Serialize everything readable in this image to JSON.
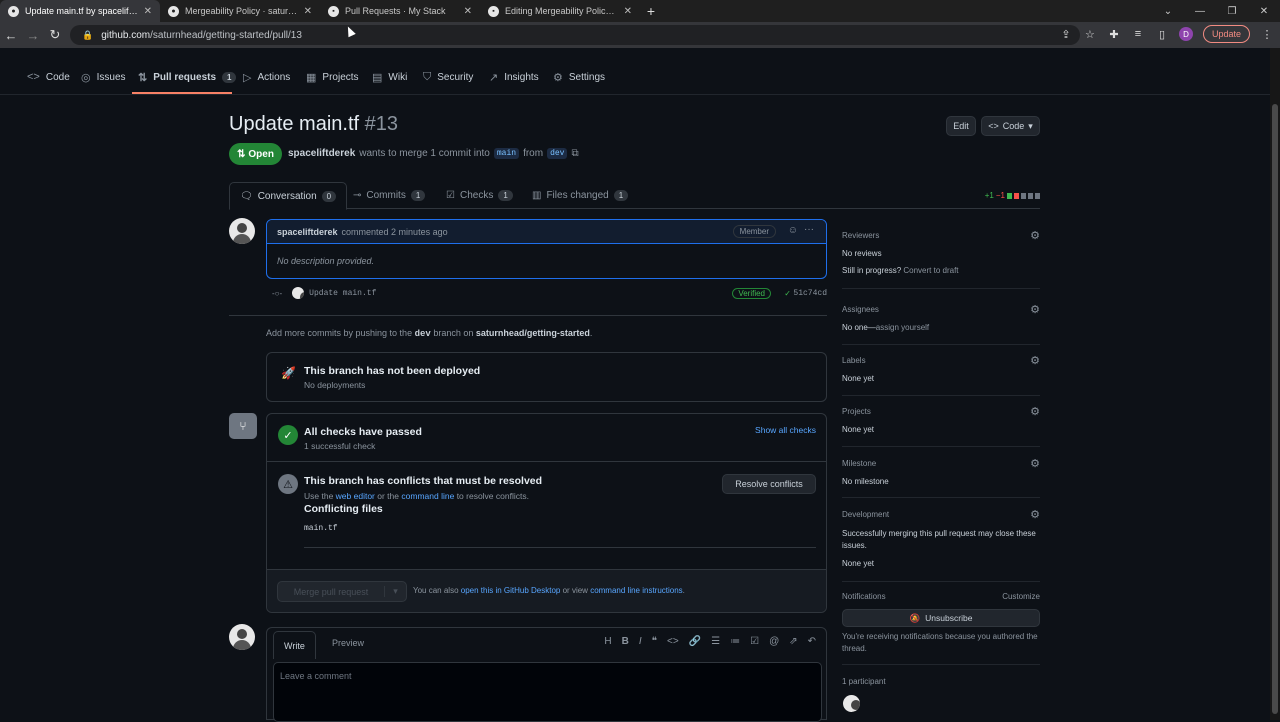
{
  "browser": {
    "tabs": [
      {
        "title": "Update main.tf by spaceliftderek",
        "active": true
      },
      {
        "title": "Mergeability Policy · saturnhead",
        "active": false
      },
      {
        "title": "Pull Requests · My Stack",
        "active": false
      },
      {
        "title": "Editing Mergeability Policy · satu",
        "active": false
      }
    ],
    "url_host": "github.com",
    "url_path": "/saturnhead/getting-started/pull/13",
    "profile_initial": "D",
    "update_label": "Update"
  },
  "repo_nav": {
    "items": [
      {
        "label": "Code",
        "icon": "code-icon"
      },
      {
        "label": "Issues",
        "icon": "issue-icon"
      },
      {
        "label": "Pull requests",
        "icon": "pull-request-icon",
        "count": "1",
        "active": true
      },
      {
        "label": "Actions",
        "icon": "play-icon"
      },
      {
        "label": "Projects",
        "icon": "table-icon"
      },
      {
        "label": "Wiki",
        "icon": "book-icon"
      },
      {
        "label": "Security",
        "icon": "shield-icon"
      },
      {
        "label": "Insights",
        "icon": "graph-icon"
      },
      {
        "label": "Settings",
        "icon": "gear-icon"
      }
    ]
  },
  "pr": {
    "title": "Update main.tf",
    "number": "#13",
    "edit_label": "Edit",
    "code_label": "Code",
    "state": "Open",
    "author": "spaceliftderek",
    "meta_text": "wants to merge 1 commit into",
    "base_branch": "main",
    "from_text": "from",
    "head_branch": "dev"
  },
  "pr_tabs": [
    {
      "label": "Conversation",
      "count": "0",
      "active": true
    },
    {
      "label": "Commits",
      "count": "1"
    },
    {
      "label": "Checks",
      "count": "1"
    },
    {
      "label": "Files changed",
      "count": "1"
    }
  ],
  "diffstat": {
    "additions": "+1",
    "deletions": "−1"
  },
  "comment": {
    "author": "spaceliftderek",
    "action": "commented 2 minutes ago",
    "badge": "Member",
    "body": "No description provided."
  },
  "commit": {
    "message": "Update main.tf",
    "verified": "Verified",
    "sha": "51c74cd"
  },
  "add_more": {
    "prefix": "Add more commits by pushing to the",
    "branch": "dev",
    "mid": "branch on",
    "repo": "saturnhead/getting-started",
    "suffix": "."
  },
  "deploy": {
    "title": "This branch has not been deployed",
    "subtitle": "No deployments"
  },
  "checks": {
    "title": "All checks have passed",
    "subtitle": "1 successful check",
    "show_all": "Show all checks"
  },
  "conflicts": {
    "title": "This branch has conflicts that must be resolved",
    "use_the": "Use the",
    "web_editor": "web editor",
    "or_the": "or the",
    "command_line": "command line",
    "to_resolve": "to resolve conflicts.",
    "resolve_button": "Resolve conflicts",
    "files_heading": "Conflicting files",
    "file": "main.tf"
  },
  "merge": {
    "button": "Merge pull request",
    "also_text": "You can also",
    "desktop_link": "open this in GitHub Desktop",
    "or_view": "or view",
    "cli_link": "command line instructions",
    "period": "."
  },
  "editor": {
    "write": "Write",
    "preview": "Preview",
    "placeholder": "Leave a comment"
  },
  "sidebar": {
    "reviewers": {
      "label": "Reviewers",
      "value": "No reviews",
      "progress": "Still in progress?",
      "convert": "Convert to draft"
    },
    "assignees": {
      "label": "Assignees",
      "value": "No one—",
      "assign": "assign yourself"
    },
    "labels": {
      "label": "Labels",
      "value": "None yet"
    },
    "projects": {
      "label": "Projects",
      "value": "None yet"
    },
    "milestone": {
      "label": "Milestone",
      "value": "No milestone"
    },
    "development": {
      "label": "Development",
      "text": "Successfully merging this pull request may close these issues.",
      "value": "None yet"
    },
    "notifications": {
      "label": "Notifications",
      "customize": "Customize",
      "unsubscribe": "Unsubscribe",
      "reason": "You're receiving notifications because you authored the thread."
    },
    "participants": {
      "label": "1 participant"
    }
  }
}
